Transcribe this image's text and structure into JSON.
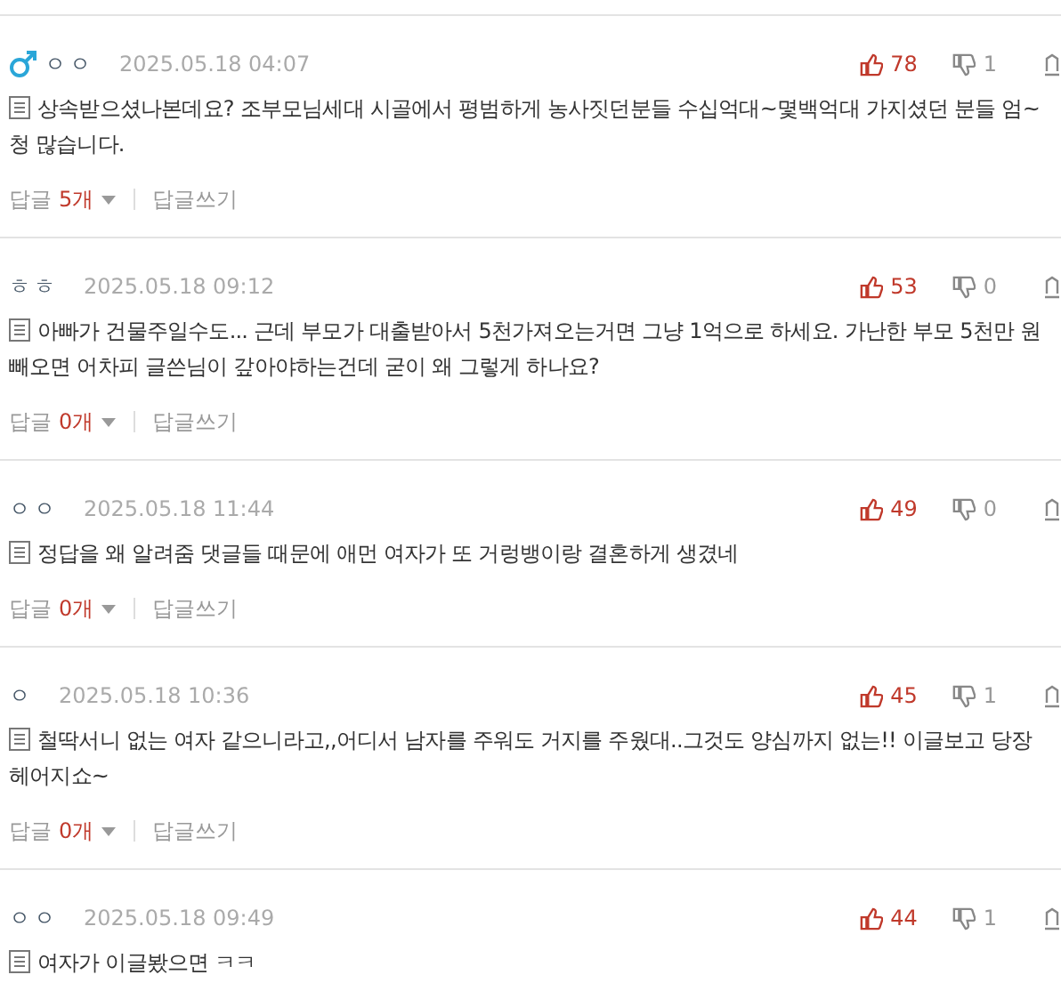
{
  "comments": [
    {
      "male": true,
      "author": "ㅇㅇ",
      "date": "2025.05.18 04:07",
      "likes": "78",
      "dislikes": "1",
      "text": "상속받으셨나본데요? 조부모님세대 시골에서 평범하게 농사짓던분들 수십억대~몇백억대 가지셨던 분들 엄~청 많습니다.",
      "reply_label": "답글",
      "reply_count": "5개",
      "write_label": "답글쓰기"
    },
    {
      "author": "ㅎㅎ",
      "date": "2025.05.18 09:12",
      "likes": "53",
      "dislikes": "0",
      "text": "아빠가 건물주일수도... 근데 부모가 대출받아서 5천가져오는거면 그냥 1억으로 하세요. 가난한 부모 5천만 원빼오면 어차피 글쓴님이 갚아야하는건데 굳이 왜 그렇게 하나요?",
      "reply_label": "답글",
      "reply_count": "0개",
      "write_label": "답글쓰기"
    },
    {
      "author": "ㅇㅇ",
      "date": "2025.05.18 11:44",
      "likes": "49",
      "dislikes": "0",
      "text": "정답을 왜 알려줌 댓글들 때문에 애먼 여자가 또 거렁뱅이랑 결혼하게 생겼네",
      "reply_label": "답글",
      "reply_count": "0개",
      "write_label": "답글쓰기"
    },
    {
      "author": "ㅇ",
      "date": "2025.05.18 10:36",
      "likes": "45",
      "dislikes": "1",
      "text": "철딱서니 없는 여자 같으니라고,,어디서 남자를 주워도 거지를 주웠대..그것도 양심까지 없는!! 이글보고 당장 헤어지쇼~",
      "reply_label": "답글",
      "reply_count": "0개",
      "write_label": "답글쓰기"
    },
    {
      "author": "ㅇㅇ",
      "date": "2025.05.18 09:49",
      "likes": "44",
      "dislikes": "1",
      "text": "여자가 이글봤으면 ㅋㅋ"
    }
  ]
}
